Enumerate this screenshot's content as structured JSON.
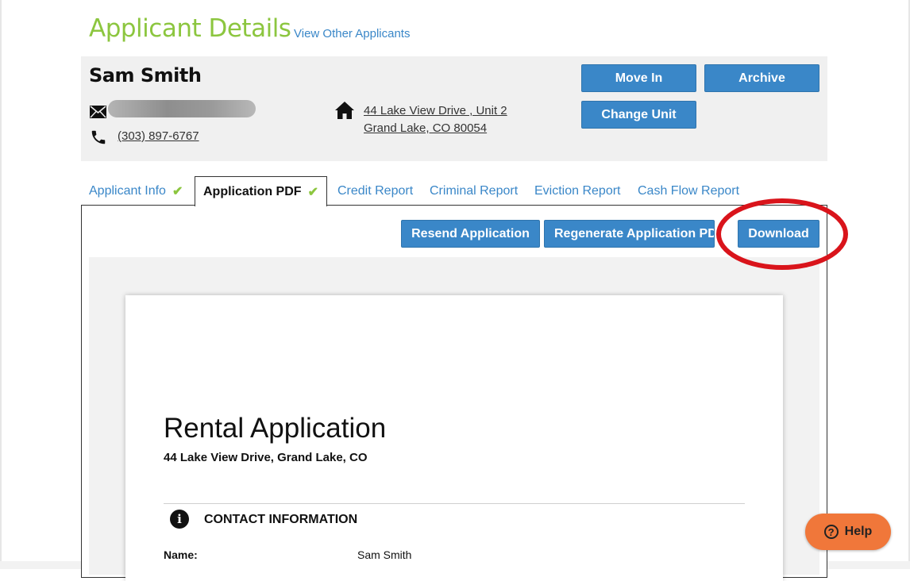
{
  "page": {
    "title": "Applicant Details",
    "view_other_link": "View Other Applicants"
  },
  "applicant": {
    "name": "Sam Smith",
    "phone": "(303) 897-6767",
    "address_line1": "44 Lake View Drive , Unit 2",
    "address_line2": "Grand Lake, CO 80054"
  },
  "actions": {
    "move_in": "Move In",
    "archive": "Archive",
    "change_unit": "Change Unit"
  },
  "tabs": [
    {
      "label": "Applicant Info",
      "checked": true
    },
    {
      "label": "Application PDF",
      "checked": true,
      "active": true
    },
    {
      "label": "Credit Report"
    },
    {
      "label": "Criminal Report"
    },
    {
      "label": "Eviction Report"
    },
    {
      "label": "Cash Flow Report"
    }
  ],
  "pdf_actions": {
    "resend": "Resend Application",
    "regenerate": "Regenerate Application PD",
    "download": "Download"
  },
  "pdf": {
    "title": "Rental Application",
    "subtitle": "44 Lake View Drive, Grand Lake, CO",
    "section_heading": "CONTACT INFORMATION",
    "name_label": "Name:",
    "name_value": "Sam Smith"
  },
  "help": {
    "label": "Help"
  },
  "colors": {
    "brand_green": "#8cc63f",
    "primary_blue": "#3a87c8",
    "help_orange": "#f0773a",
    "highlight_red": "#d9141b"
  },
  "icons": {
    "email": "envelope-icon",
    "phone": "phone-icon",
    "address": "home-icon",
    "info": "info-icon",
    "help": "question-icon"
  }
}
